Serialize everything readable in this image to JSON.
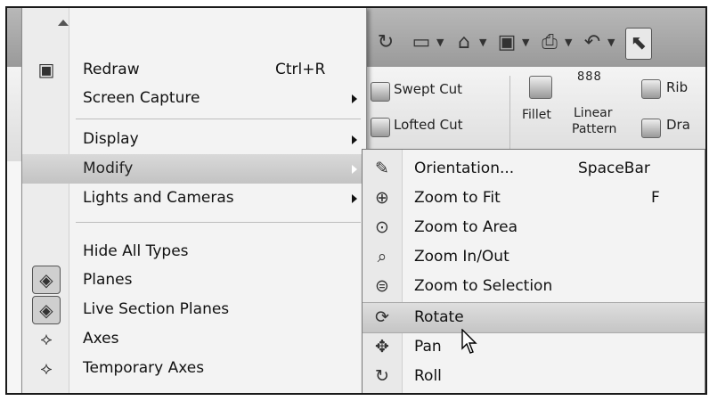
{
  "toolbar": {
    "buttons": [
      "rebuild-icon",
      "new-document-icon",
      "open-icon",
      "save-icon",
      "print-icon",
      "undo-icon",
      "select-icon"
    ]
  },
  "ribbon": {
    "swept_cut": "Swept Cut",
    "lofted_cut": "Lofted Cut",
    "fillet": "Fillet",
    "linear_pattern_line1": "Linear",
    "linear_pattern_line2": "Pattern",
    "rib": "Rib",
    "draft": "Dra"
  },
  "view_menu": {
    "items": [
      {
        "label": "Redraw",
        "shortcut": "Ctrl+R",
        "icon": "redraw-icon"
      },
      {
        "label": "Screen Capture",
        "has_submenu": true
      },
      {
        "label": "Display",
        "has_submenu": true
      },
      {
        "label": "Modify",
        "has_submenu": true,
        "highlighted": true
      },
      {
        "label": "Lights and Cameras",
        "has_submenu": true
      },
      {
        "label": "Hide All Types"
      },
      {
        "label": "Planes",
        "icon": "planes-icon"
      },
      {
        "label": "Live Section Planes",
        "icon": "live-section-planes-icon"
      },
      {
        "label": "Axes",
        "icon": "axes-icon"
      },
      {
        "label": "Temporary Axes",
        "icon": "temporary-axes-icon"
      }
    ]
  },
  "modify_submenu": {
    "items": [
      {
        "label": "Orientation...",
        "shortcut": "SpaceBar",
        "icon": "orientation-icon"
      },
      {
        "label": "Zoom to Fit",
        "shortcut": "F",
        "icon": "zoom-to-fit-icon"
      },
      {
        "label": "Zoom to Area",
        "icon": "zoom-to-area-icon"
      },
      {
        "label": "Zoom In/Out",
        "icon": "zoom-in-out-icon"
      },
      {
        "label": "Zoom to Selection",
        "icon": "zoom-to-selection-icon"
      },
      {
        "label": "Rotate",
        "icon": "rotate-icon",
        "highlighted": true
      },
      {
        "label": "Pan",
        "icon": "pan-icon"
      },
      {
        "label": "Roll",
        "icon": "roll-icon"
      }
    ]
  },
  "colors": {
    "menu_bg": "#f3f3f3",
    "highlight": "#c9c9c9",
    "border": "#1a1a1a"
  }
}
